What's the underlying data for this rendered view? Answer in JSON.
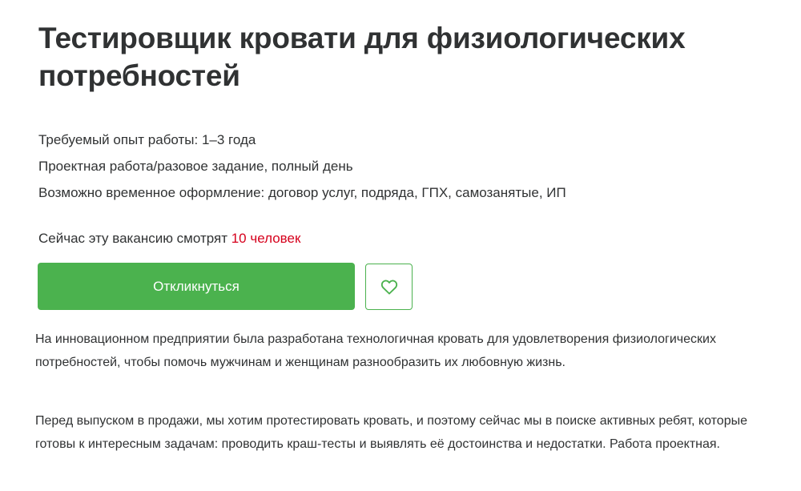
{
  "vacancy": {
    "title": "Тестировщик кровати для физиологических потребностей",
    "experience": "Требуемый опыт работы: 1–3 года",
    "employment": "Проектная работа/разовое задание, полный день",
    "registration": "Возможно временное оформление: договор услуг, подряда, ГПХ, самозанятые, ИП",
    "watching_prefix": "Сейчас эту вакансию смотрят ",
    "watching_count": "10 человек",
    "apply_label": "Откликнуться",
    "favorite_icon": "heart-icon",
    "description": [
      "На инновационном предприятии была разработана технологичная кровать для удовлетворения физиологических потребностей, чтобы помочь мужчинам и женщинам разнообразить их любовную жизнь.",
      "Перед выпуском в продажи, мы хотим протестировать кровать, и поэтому сейчас мы в поиске активных ребят, которые готовы к интересным задачам: проводить краш-тесты и выявлять её достоинства и недостатки. Работа проектная."
    ]
  },
  "colors": {
    "accent_green": "#4bb24e",
    "highlight_red": "#d6001c",
    "text": "#303233"
  }
}
